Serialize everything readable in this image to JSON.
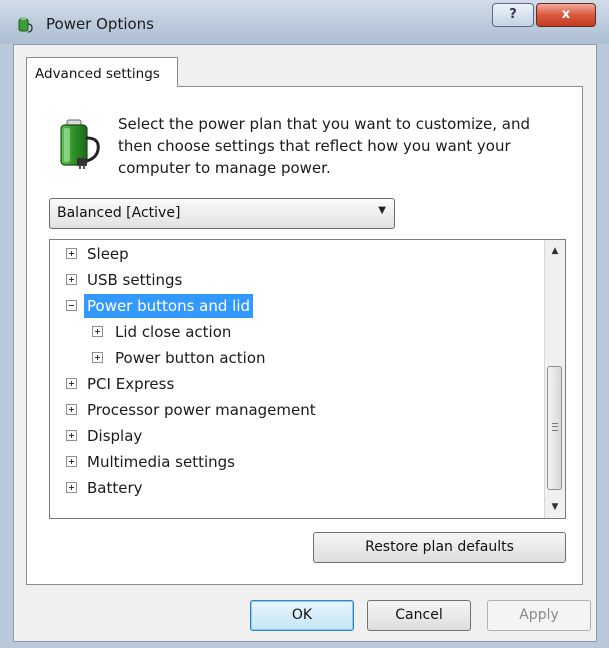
{
  "window": {
    "title": "Power Options",
    "help_label": "?",
    "close_label": "x"
  },
  "tab": {
    "label": "Advanced settings"
  },
  "description": "Select the power plan that you want to customize, and then choose settings that reflect how you want your computer to manage power.",
  "plan_select": {
    "value": "Balanced [Active]"
  },
  "tree": {
    "items": [
      {
        "label": "Sleep",
        "level": 0,
        "expander": "plus",
        "selected": false
      },
      {
        "label": "USB settings",
        "level": 0,
        "expander": "plus",
        "selected": false
      },
      {
        "label": "Power buttons and lid",
        "level": 0,
        "expander": "minus",
        "selected": true
      },
      {
        "label": "Lid close action",
        "level": 1,
        "expander": "plus",
        "selected": false
      },
      {
        "label": "Power button action",
        "level": 1,
        "expander": "plus",
        "selected": false
      },
      {
        "label": "PCI Express",
        "level": 0,
        "expander": "plus",
        "selected": false
      },
      {
        "label": "Processor power management",
        "level": 0,
        "expander": "plus",
        "selected": false
      },
      {
        "label": "Display",
        "level": 0,
        "expander": "plus",
        "selected": false
      },
      {
        "label": "Multimedia settings",
        "level": 0,
        "expander": "plus",
        "selected": false
      },
      {
        "label": "Battery",
        "level": 0,
        "expander": "plus",
        "selected": false
      }
    ]
  },
  "buttons": {
    "restore_label": "Restore plan defaults",
    "ok_label": "OK",
    "cancel_label": "Cancel",
    "apply_label": "Apply"
  },
  "icons": {
    "app_icon": "power-options-icon",
    "battery_icon": "battery-plug-icon"
  },
  "colors": {
    "selection": "#3399ff",
    "titlebar": "#bccbdc",
    "close_button": "#c23b22"
  }
}
